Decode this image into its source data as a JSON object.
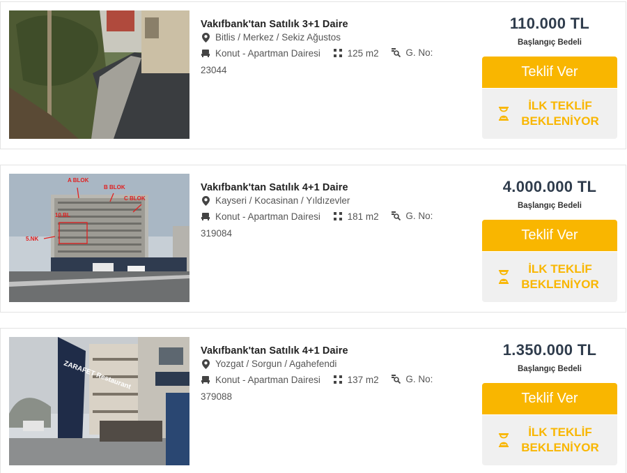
{
  "listings": [
    {
      "title": "Vakıfbank'tan Satılık 3+1 Daire",
      "location": "Bitlis / Merkez / Sekiz Ağustos",
      "category": "Konut - Apartman Dairesi",
      "area": "125 m2",
      "gno_label": "G. No:",
      "gno": "23044",
      "price": "110.000 TL",
      "price_label": "Başlangıç Bedeli",
      "bid_label": "Teklif Ver",
      "status": "İLK TEKLİF BEKLENİYOR"
    },
    {
      "title": "Vakıfbank'tan Satılık 4+1 Daire",
      "location": "Kayseri / Kocasinan / Yıldızevler",
      "category": "Konut - Apartman Dairesi",
      "area": "181 m2",
      "gno_label": "G. No:",
      "gno": "319084",
      "price": "4.000.000 TL",
      "price_label": "Başlangıç Bedeli",
      "bid_label": "Teklif Ver",
      "status": "İLK TEKLİF BEKLENİYOR",
      "photo_labels": [
        "A BLOK",
        "B BLOK",
        "C BLOK",
        "5.NK",
        "10.BL"
      ]
    },
    {
      "title": "Vakıfbank'tan Satılık 4+1 Daire",
      "location": "Yozgat / Sorgun / Agahefendi",
      "category": "Konut - Apartman Dairesi",
      "area": "137 m2",
      "gno_label": "G. No:",
      "gno": "379088",
      "price": "1.350.000 TL",
      "price_label": "Başlangıç Bedeli",
      "bid_label": "Teklif Ver",
      "status": "İLK TEKLİF BEKLENİYOR",
      "photo_sign": "ZARAFET Restaurant"
    }
  ],
  "colors": {
    "accent": "#f9b600",
    "price": "#2f3c4c",
    "waiting_bg": "#f0f0f0"
  }
}
